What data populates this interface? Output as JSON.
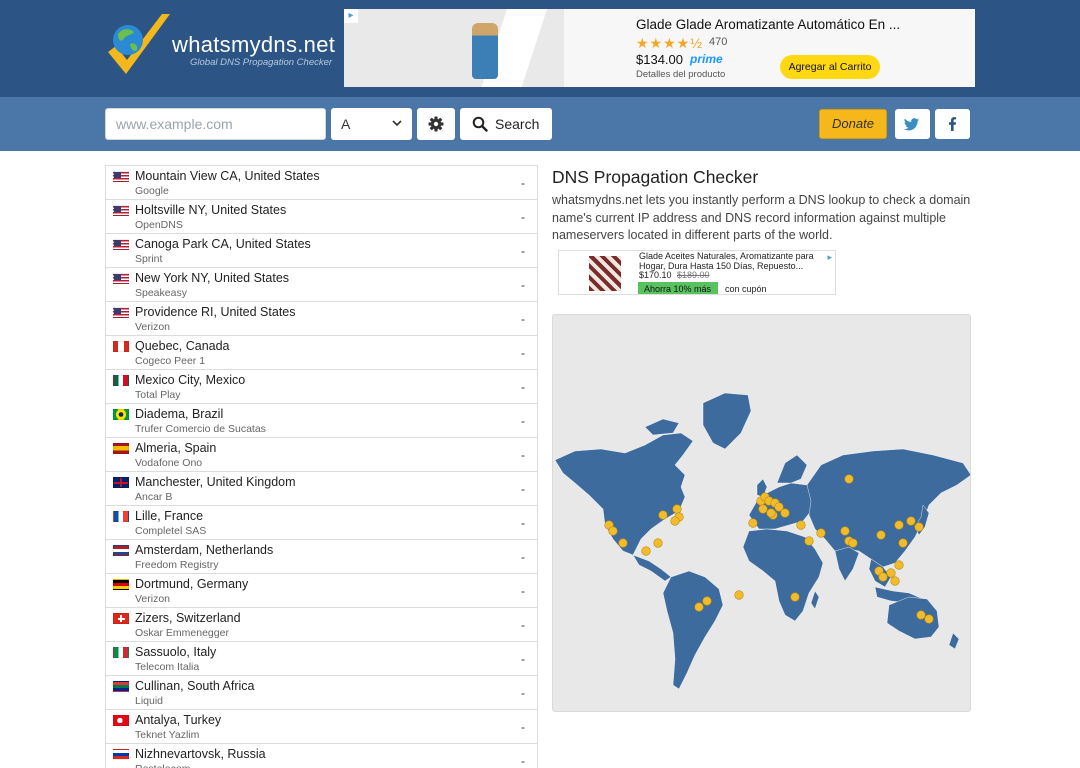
{
  "header": {
    "site_name": "whatsmydns.net",
    "tagline": "Global DNS Propagation Checker"
  },
  "top_ad": {
    "title": "Glade Glade Aromatizante Automático En ...",
    "stars": "★★★★½",
    "reviews": "470",
    "price": "$134.00",
    "prime": "prime",
    "details": "Detalles del producto",
    "cart_button": "Agregar al Carrito"
  },
  "search": {
    "placeholder": "www.example.com",
    "record_type": "A",
    "search_label": "Search",
    "donate_label": "Donate"
  },
  "colors": {
    "header_bg": "#2c5484",
    "search_bg": "#4a76a8",
    "map_land": "#3d6b9e",
    "marker": "#f2bb2b"
  },
  "servers": [
    {
      "location": "Mountain View CA, United States",
      "provider": "Google",
      "result": "-",
      "flag": "us"
    },
    {
      "location": "Holtsville NY, United States",
      "provider": "OpenDNS",
      "result": "-",
      "flag": "us"
    },
    {
      "location": "Canoga Park CA, United States",
      "provider": "Sprint",
      "result": "-",
      "flag": "us"
    },
    {
      "location": "New York NY, United States",
      "provider": "Speakeasy",
      "result": "-",
      "flag": "us"
    },
    {
      "location": "Providence RI, United States",
      "provider": "Verizon",
      "result": "-",
      "flag": "us"
    },
    {
      "location": "Quebec, Canada",
      "provider": "Cogeco Peer 1",
      "result": "-",
      "flag": "ca"
    },
    {
      "location": "Mexico City, Mexico",
      "provider": "Total Play",
      "result": "-",
      "flag": "mx"
    },
    {
      "location": "Diadema, Brazil",
      "provider": "Trufer Comercio de Sucatas",
      "result": "-",
      "flag": "br"
    },
    {
      "location": "Almeria, Spain",
      "provider": "Vodafone Ono",
      "result": "-",
      "flag": "es"
    },
    {
      "location": "Manchester, United Kingdom",
      "provider": "Ancar B",
      "result": "-",
      "flag": "gb"
    },
    {
      "location": "Lille, France",
      "provider": "Completel SAS",
      "result": "-",
      "flag": "fr"
    },
    {
      "location": "Amsterdam, Netherlands",
      "provider": "Freedom Registry",
      "result": "-",
      "flag": "nl"
    },
    {
      "location": "Dortmund, Germany",
      "provider": "Verizon",
      "result": "-",
      "flag": "de"
    },
    {
      "location": "Zizers, Switzerland",
      "provider": "Oskar Emmenegger",
      "result": "-",
      "flag": "ch"
    },
    {
      "location": "Sassuolo, Italy",
      "provider": "Telecom Italia",
      "result": "-",
      "flag": "it"
    },
    {
      "location": "Cullinan, South Africa",
      "provider": "Liquid",
      "result": "-",
      "flag": "za"
    },
    {
      "location": "Antalya, Turkey",
      "provider": "Teknet Yazlim",
      "result": "-",
      "flag": "tr"
    },
    {
      "location": "Nizhnevartovsk, Russia",
      "provider": "Rostelecom",
      "result": "-",
      "flag": "ru"
    }
  ],
  "intro": {
    "title": "DNS Propagation Checker",
    "description": "whatsmydns.net lets you instantly perform a DNS lookup to check a domain name's current IP address and DNS record information against multiple nameservers located in different parts of the world."
  },
  "mid_ad": {
    "title": "Glade Aceites Naturales, Aromatizante para Hogar, Dura Hasta 150 Días, Repuesto...",
    "price": "$170.10",
    "old_price": "$189.00",
    "badge": "Ahorra 10% más",
    "coupon": "con cupón"
  }
}
